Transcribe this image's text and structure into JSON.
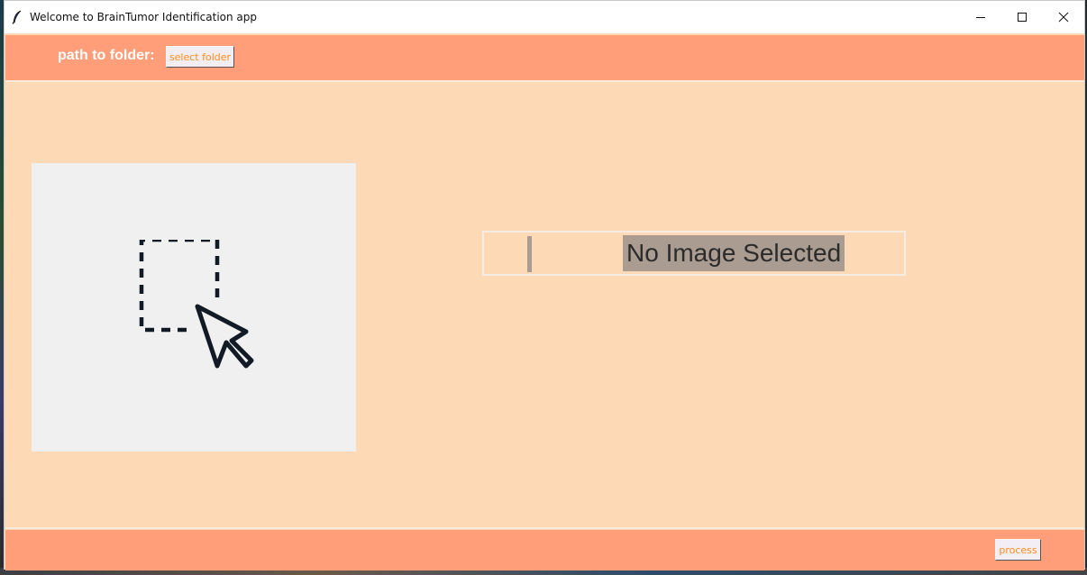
{
  "window": {
    "title": "Welcome to BrainTumor Identification app",
    "controls": [
      "minimize-icon",
      "maximize-icon",
      "close-icon"
    ]
  },
  "toolbar": {
    "path_label": "path to folder:",
    "select_folder_label": "select folder"
  },
  "main": {
    "drop_zone_icon": "drag-select-cursor-icon",
    "status_text": "No Image Selected"
  },
  "footer": {
    "process_label": "process"
  },
  "colors": {
    "bar": "#ff9e79",
    "background": "#fdd9b6",
    "button_text": "#ff8c1a",
    "image_panel": "#f0f0f0",
    "status_highlight": "#aa9c90"
  }
}
